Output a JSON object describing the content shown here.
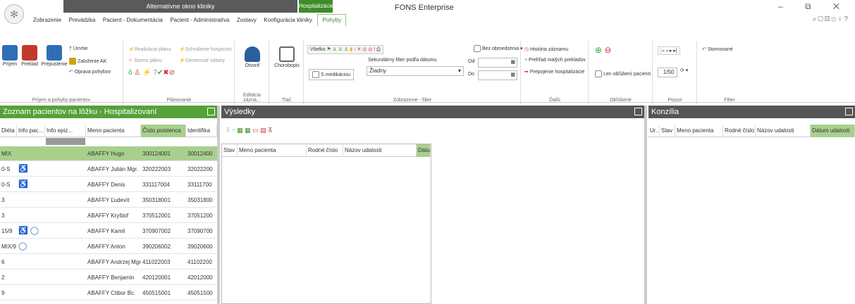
{
  "window": {
    "title": "FONS Enterprise",
    "context_tab_group": "Alternatívne okno kliniky",
    "context_tab_hosp": "Hospitalizácie",
    "controls": "– ⧉ ✕",
    "quick_icons": "⌕▢▤⊙♀?"
  },
  "menu": {
    "items": [
      "Zobrazenie",
      "Prevádzka",
      "Pacient - Dokumentácia",
      "Pacient - Administratíva",
      "Zostavy",
      "Konfigurácia kliniky",
      "Pohyby"
    ],
    "active": "Pohyby"
  },
  "ribbon": {
    "group1": {
      "label": "Príjem a pohyby pacientov",
      "btn_prijem": "Príjem",
      "btn_preklad": "Preklad",
      "btn_prepustenie": "Prepustenie",
      "btn_umrtie": "Úmrtie",
      "btn_zalozenie": "Založenie AK",
      "btn_oprava": "Oprava pohybov"
    },
    "group2": {
      "label": "Plánovanie",
      "realizacia": "Realizácia plánu",
      "schvalenie": "Schválenie hospicom",
      "storno": "Storno plánu",
      "generovat": "Generovať súbory"
    },
    "group3": {
      "label": "Editácia zázna...",
      "otvorit": "Otvoriť"
    },
    "group4": {
      "label": "Tlač",
      "chorobopis": "Chorobopis"
    },
    "group5": {
      "label": "Zobrazenie - filter",
      "vsetko": "Všetko",
      "s_medikaciou": "S medikáciou",
      "sec_filter_label": "Sekundárny filter podľa dátumu",
      "sec_filter_value": "Žiadny",
      "od": "Od",
      "do": "Do",
      "bez_obmedzenia": "Bez obmedzenia"
    },
    "group6": {
      "label": "Ďalší",
      "historia": "História záznamu",
      "prehlad": "Prehľad malých prekladov",
      "prepojenie": "Prepojenie hospitalizácie"
    },
    "group7": {
      "label": "Obľúbené",
      "len_oblubeni": "Len obľúbení pacienti"
    },
    "group8": {
      "label": "Posun",
      "page": "1/50"
    },
    "group9": {
      "label": "Filter",
      "stornovane": "Stornované"
    }
  },
  "left_panel": {
    "title": "Zoznam pacientov na lôžku - Hospitalizovaní",
    "columns": [
      "Diéta",
      "Info pac...",
      "Info epiz...",
      "Meno pacienta",
      "Číslo poistenca",
      "Identifika"
    ],
    "rows": [
      {
        "dieta": "MIX",
        "info": "",
        "meno": "ABAFFY Hugo",
        "cislo": "300124001",
        "id": "30012400"
      },
      {
        "dieta": "0-S",
        "info": "♿",
        "meno": "ABAFFY Julián Mgr.",
        "cislo": "320222003",
        "id": "32022200"
      },
      {
        "dieta": "0-S",
        "info": "♿",
        "meno": "ABAFFY Denis",
        "cislo": "331117004",
        "id": "33111700"
      },
      {
        "dieta": "3",
        "info": "",
        "meno": "ABAFFY Ľudevít",
        "cislo": "350318001",
        "id": "35031800"
      },
      {
        "dieta": "3",
        "info": "",
        "meno": "ABAFFY Kryštof",
        "cislo": "370512001",
        "id": "37051200"
      },
      {
        "dieta": "15/9",
        "info": "♿ ◯",
        "meno": "ABAFFY Kamil",
        "cislo": "370907002",
        "id": "37090700"
      },
      {
        "dieta": "MIX/9",
        "info": "◯",
        "meno": "ABAFFY Anton",
        "cislo": "390206002",
        "id": "39020600"
      },
      {
        "dieta": "6",
        "info": "",
        "meno": "ABAFFY Andrzej Mgr.",
        "cislo": "411022003",
        "id": "41102200"
      },
      {
        "dieta": "2",
        "info": "",
        "meno": "ABAFFY Benjamin",
        "cislo": "420120001",
        "id": "42012000"
      },
      {
        "dieta": "9",
        "info": "",
        "meno": "ABAFFY Ctibor Bc.",
        "cislo": "450515001",
        "id": "45051500"
      }
    ]
  },
  "mid_panel": {
    "title": "Výsledky",
    "columns": [
      "Stav",
      "Meno pacienta",
      "Rodné číslo",
      "Názov udalosti",
      "Dátu"
    ]
  },
  "right_panel": {
    "title": "Konzília",
    "columns": [
      "Ur...",
      "Stav",
      "Meno pacienta",
      "Rodné číslo",
      "Názov udalosti",
      "Dátum udalosti"
    ]
  },
  "colors": {
    "green": "#3e8c28",
    "panel_green": "#55a13a",
    "panel_dark": "#555555",
    "selected": "#a8d08d"
  }
}
